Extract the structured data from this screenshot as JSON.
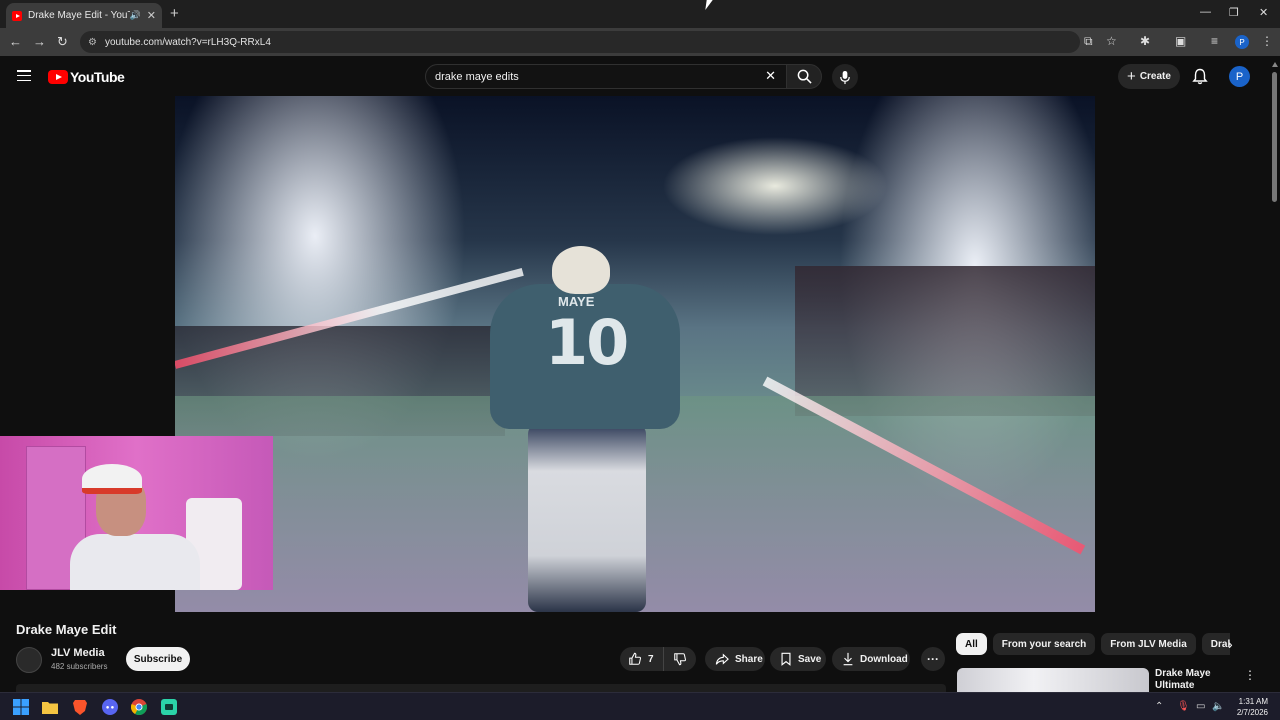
{
  "browser": {
    "tab_title": "Drake Maye Edit - YouTube",
    "url": "youtube.com/watch?v=rLH3Q-RRxL4"
  },
  "header": {
    "logo_text": "YouTube",
    "search_value": "drake maye edits",
    "create_label": "Create",
    "avatar_letter": "P"
  },
  "video": {
    "jersey_name": "MAYE",
    "jersey_number": "10"
  },
  "watch": {
    "title": "Drake Maye Edit",
    "channel_name": "JLV Media",
    "subscribers": "482 subscribers",
    "subscribe_label": "Subscribe",
    "like_count": "7",
    "share_label": "Share",
    "save_label": "Save",
    "download_label": "Download"
  },
  "chips": [
    "All",
    "From your search",
    "From JLV Media",
    "Drake Ma"
  ],
  "recommendation": {
    "title": "Drake Maye Ultimate Highlight"
  },
  "taskbar": {
    "time": "1:31 AM",
    "date": "2/7/2026"
  },
  "colors": {
    "youtube_red": "#ff0000",
    "background": "#0f0f0f",
    "button_bg": "#272727",
    "avatar_blue": "#1a63c9"
  }
}
